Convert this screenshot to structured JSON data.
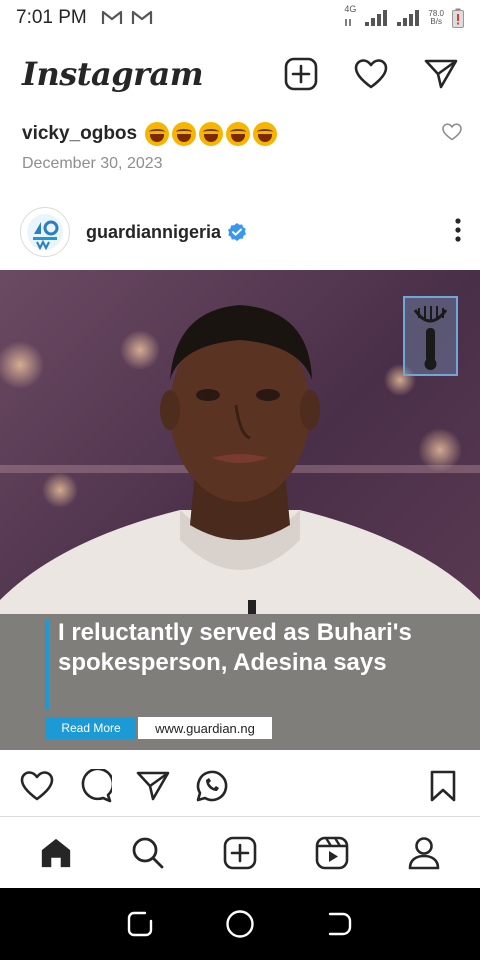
{
  "status_bar": {
    "time": "7:01 PM",
    "network": "4G",
    "speed_value": "78.0",
    "speed_unit": "B/s",
    "icons": [
      "gmail-icon",
      "gmail-icon",
      "signal-icon",
      "signal-icon",
      "battery-icon"
    ]
  },
  "header": {
    "logo": "Instagram",
    "icons": [
      "new-post-icon",
      "heart-icon",
      "direct-message-icon"
    ]
  },
  "shared_by": {
    "username": "vicky_ogbos",
    "emoji_count": 5,
    "emoji": "laughing-tears",
    "date": "December 30, 2023"
  },
  "post": {
    "username": "guardiannigeria",
    "verified": true,
    "headline": "I reluctantly served as Buhari's spokesperson, Adesina says",
    "read_more_label": "Read More",
    "site_url": "www.guardian.ng"
  },
  "actions": [
    "like-icon",
    "comment-icon",
    "share-icon",
    "whatsapp-icon",
    "bookmark-icon"
  ],
  "bottom_nav": [
    "home-icon",
    "search-icon",
    "create-icon",
    "reels-icon",
    "profile-icon"
  ],
  "colors": {
    "accent_blue": "#1b9ad6",
    "verified_blue": "#3897f0",
    "text": "#262626",
    "muted": "#8e8e8e"
  }
}
